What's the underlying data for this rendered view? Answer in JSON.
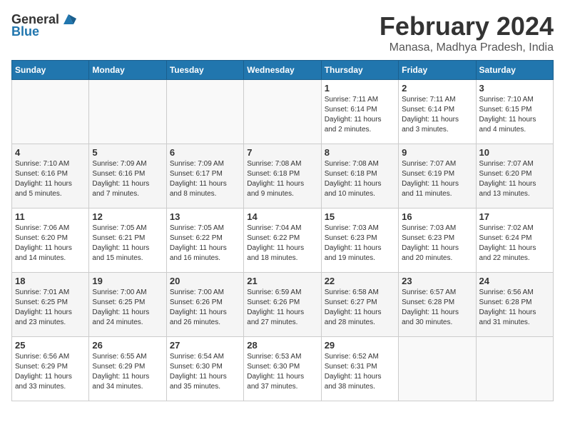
{
  "header": {
    "logo": {
      "text_general": "General",
      "text_blue": "Blue",
      "icon_alt": "GeneralBlue logo"
    },
    "title": "February 2024",
    "subtitle": "Manasa, Madhya Pradesh, India"
  },
  "days_of_week": [
    "Sunday",
    "Monday",
    "Tuesday",
    "Wednesday",
    "Thursday",
    "Friday",
    "Saturday"
  ],
  "weeks": [
    [
      {
        "day": "",
        "info": ""
      },
      {
        "day": "",
        "info": ""
      },
      {
        "day": "",
        "info": ""
      },
      {
        "day": "",
        "info": ""
      },
      {
        "day": "1",
        "info": "Sunrise: 7:11 AM\nSunset: 6:14 PM\nDaylight: 11 hours\nand 2 minutes."
      },
      {
        "day": "2",
        "info": "Sunrise: 7:11 AM\nSunset: 6:14 PM\nDaylight: 11 hours\nand 3 minutes."
      },
      {
        "day": "3",
        "info": "Sunrise: 7:10 AM\nSunset: 6:15 PM\nDaylight: 11 hours\nand 4 minutes."
      }
    ],
    [
      {
        "day": "4",
        "info": "Sunrise: 7:10 AM\nSunset: 6:16 PM\nDaylight: 11 hours\nand 5 minutes."
      },
      {
        "day": "5",
        "info": "Sunrise: 7:09 AM\nSunset: 6:16 PM\nDaylight: 11 hours\nand 7 minutes."
      },
      {
        "day": "6",
        "info": "Sunrise: 7:09 AM\nSunset: 6:17 PM\nDaylight: 11 hours\nand 8 minutes."
      },
      {
        "day": "7",
        "info": "Sunrise: 7:08 AM\nSunset: 6:18 PM\nDaylight: 11 hours\nand 9 minutes."
      },
      {
        "day": "8",
        "info": "Sunrise: 7:08 AM\nSunset: 6:18 PM\nDaylight: 11 hours\nand 10 minutes."
      },
      {
        "day": "9",
        "info": "Sunrise: 7:07 AM\nSunset: 6:19 PM\nDaylight: 11 hours\nand 11 minutes."
      },
      {
        "day": "10",
        "info": "Sunrise: 7:07 AM\nSunset: 6:20 PM\nDaylight: 11 hours\nand 13 minutes."
      }
    ],
    [
      {
        "day": "11",
        "info": "Sunrise: 7:06 AM\nSunset: 6:20 PM\nDaylight: 11 hours\nand 14 minutes."
      },
      {
        "day": "12",
        "info": "Sunrise: 7:05 AM\nSunset: 6:21 PM\nDaylight: 11 hours\nand 15 minutes."
      },
      {
        "day": "13",
        "info": "Sunrise: 7:05 AM\nSunset: 6:22 PM\nDaylight: 11 hours\nand 16 minutes."
      },
      {
        "day": "14",
        "info": "Sunrise: 7:04 AM\nSunset: 6:22 PM\nDaylight: 11 hours\nand 18 minutes."
      },
      {
        "day": "15",
        "info": "Sunrise: 7:03 AM\nSunset: 6:23 PM\nDaylight: 11 hours\nand 19 minutes."
      },
      {
        "day": "16",
        "info": "Sunrise: 7:03 AM\nSunset: 6:23 PM\nDaylight: 11 hours\nand 20 minutes."
      },
      {
        "day": "17",
        "info": "Sunrise: 7:02 AM\nSunset: 6:24 PM\nDaylight: 11 hours\nand 22 minutes."
      }
    ],
    [
      {
        "day": "18",
        "info": "Sunrise: 7:01 AM\nSunset: 6:25 PM\nDaylight: 11 hours\nand 23 minutes."
      },
      {
        "day": "19",
        "info": "Sunrise: 7:00 AM\nSunset: 6:25 PM\nDaylight: 11 hours\nand 24 minutes."
      },
      {
        "day": "20",
        "info": "Sunrise: 7:00 AM\nSunset: 6:26 PM\nDaylight: 11 hours\nand 26 minutes."
      },
      {
        "day": "21",
        "info": "Sunrise: 6:59 AM\nSunset: 6:26 PM\nDaylight: 11 hours\nand 27 minutes."
      },
      {
        "day": "22",
        "info": "Sunrise: 6:58 AM\nSunset: 6:27 PM\nDaylight: 11 hours\nand 28 minutes."
      },
      {
        "day": "23",
        "info": "Sunrise: 6:57 AM\nSunset: 6:28 PM\nDaylight: 11 hours\nand 30 minutes."
      },
      {
        "day": "24",
        "info": "Sunrise: 6:56 AM\nSunset: 6:28 PM\nDaylight: 11 hours\nand 31 minutes."
      }
    ],
    [
      {
        "day": "25",
        "info": "Sunrise: 6:56 AM\nSunset: 6:29 PM\nDaylight: 11 hours\nand 33 minutes."
      },
      {
        "day": "26",
        "info": "Sunrise: 6:55 AM\nSunset: 6:29 PM\nDaylight: 11 hours\nand 34 minutes."
      },
      {
        "day": "27",
        "info": "Sunrise: 6:54 AM\nSunset: 6:30 PM\nDaylight: 11 hours\nand 35 minutes."
      },
      {
        "day": "28",
        "info": "Sunrise: 6:53 AM\nSunset: 6:30 PM\nDaylight: 11 hours\nand 37 minutes."
      },
      {
        "day": "29",
        "info": "Sunrise: 6:52 AM\nSunset: 6:31 PM\nDaylight: 11 hours\nand 38 minutes."
      },
      {
        "day": "",
        "info": ""
      },
      {
        "day": "",
        "info": ""
      }
    ]
  ]
}
